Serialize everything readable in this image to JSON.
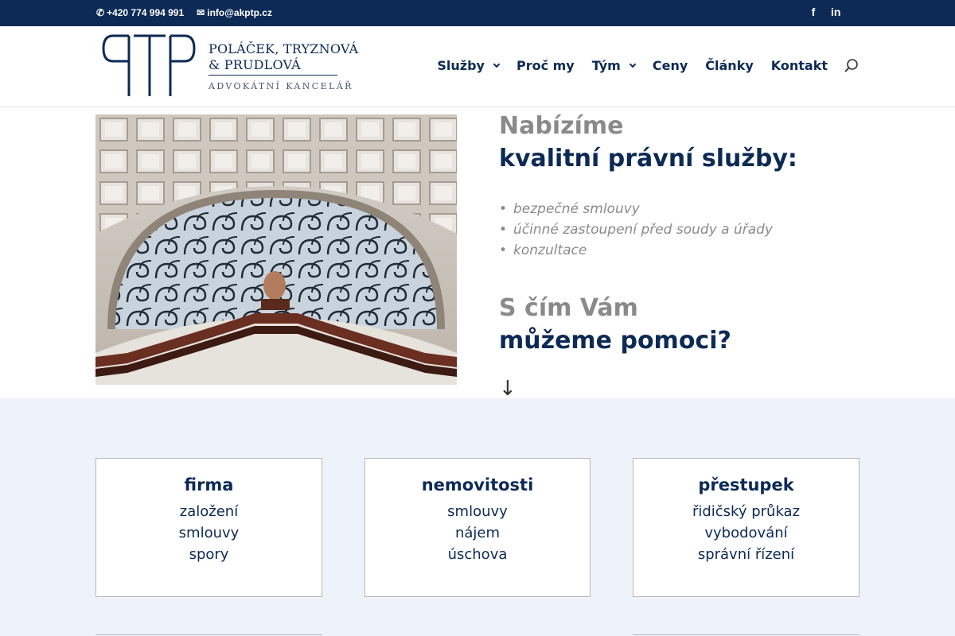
{
  "topbar": {
    "phone": "+420 774 994 991",
    "email": "info@akptp.cz",
    "social": [
      {
        "icon": "facebook-icon",
        "glyph": "f"
      },
      {
        "icon": "linkedin-icon",
        "glyph": "in"
      }
    ]
  },
  "logo": {
    "line1": "POLÁČEK, TRYZNOVÁ",
    "line2": "& PRUDLOVÁ",
    "line3": "ADVOKÁTNÍ KANCELÁŘ"
  },
  "nav": {
    "items": [
      {
        "label": "Služby",
        "has_dropdown": true
      },
      {
        "label": "Proč my",
        "has_dropdown": false
      },
      {
        "label": "Tým",
        "has_dropdown": true
      },
      {
        "label": "Ceny",
        "has_dropdown": false
      },
      {
        "label": "Články",
        "has_dropdown": false
      },
      {
        "label": "Kontakt",
        "has_dropdown": false
      }
    ]
  },
  "hero": {
    "heading_grey": "Nabízíme",
    "heading_blue": "kvalitní právní služby:",
    "services": [
      "bezpečné smlouvy",
      "účinné zastoupení před soudy a úřady",
      "konzultace"
    ],
    "help_grey": "S čím Vám",
    "help_blue": "můžeme pomoci?",
    "arrow": "↓"
  },
  "cards": [
    {
      "title": "firma",
      "items": [
        "založení",
        "smlouvy",
        "spory"
      ]
    },
    {
      "title": "nemovitosti",
      "items": [
        "smlouvy",
        "nájem",
        "úschova"
      ]
    },
    {
      "title": "přestupek",
      "items": [
        "řidičský průkaz",
        "vybodování",
        "správní řízení"
      ]
    }
  ],
  "colors": {
    "brand_navy": "#0c2a55",
    "grey_text": "#8a8a8a",
    "lower_bg": "#eef3fa"
  }
}
